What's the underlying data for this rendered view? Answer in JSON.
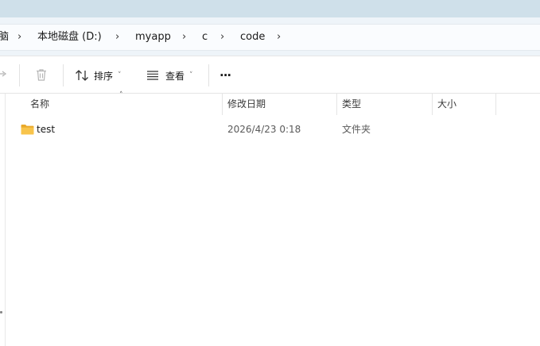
{
  "address": {
    "crumbs": [
      "脑",
      "本地磁盘 (D:)",
      "myapp",
      "c",
      "code"
    ],
    "separator": "›"
  },
  "toolbar": {
    "share_icon": "share-icon",
    "delete_icon": "trash-icon",
    "sort_label": "排序",
    "view_label": "查看",
    "more_label": "···",
    "caret": "˅"
  },
  "columns": {
    "name": "名称",
    "modified": "修改日期",
    "type": "类型",
    "size": "大小",
    "sort_indicator": "˄"
  },
  "files": [
    {
      "name": "test",
      "modified": "2026/4/23 0:18",
      "type": "文件夹",
      "size": "",
      "icon": "folder-icon"
    }
  ],
  "colors": {
    "folder": "#f8c44b",
    "accent": "#cfe0ea"
  }
}
